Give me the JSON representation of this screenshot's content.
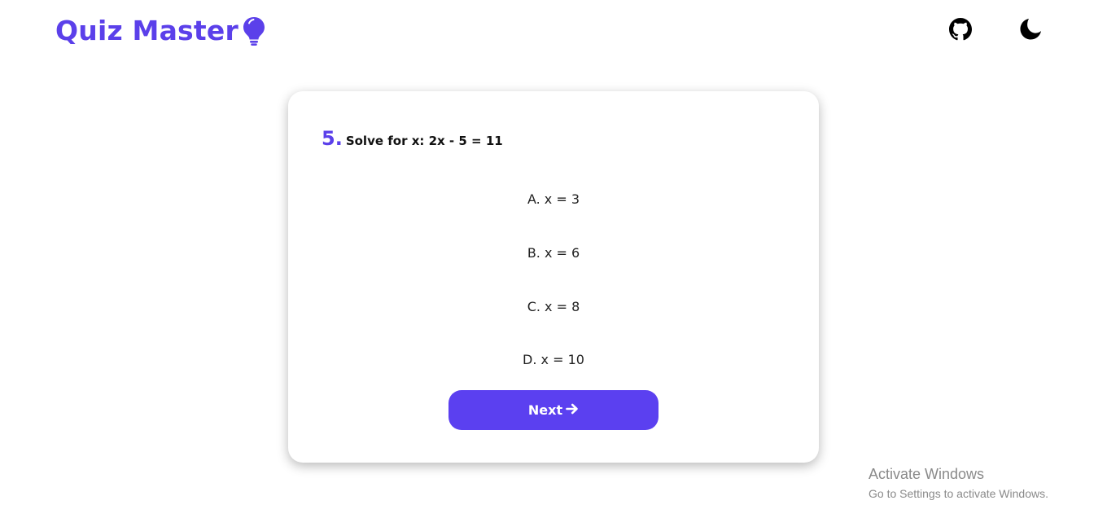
{
  "header": {
    "title": "Quiz Master",
    "brand_color": "#5b40ea",
    "icons": [
      "lightbulb-icon",
      "github-icon",
      "moon-icon"
    ]
  },
  "quiz": {
    "question_number": "5.",
    "question_text": "Solve for x: 2x - 5 = 11",
    "options": [
      "A. x = 3",
      "B. x = 6",
      "C. x = 8",
      "D. x = 10"
    ],
    "next_label": "Next",
    "next_color": "#5b40f0"
  },
  "watermark": {
    "title": "Activate Windows",
    "subtitle": "Go to Settings to activate Windows."
  }
}
